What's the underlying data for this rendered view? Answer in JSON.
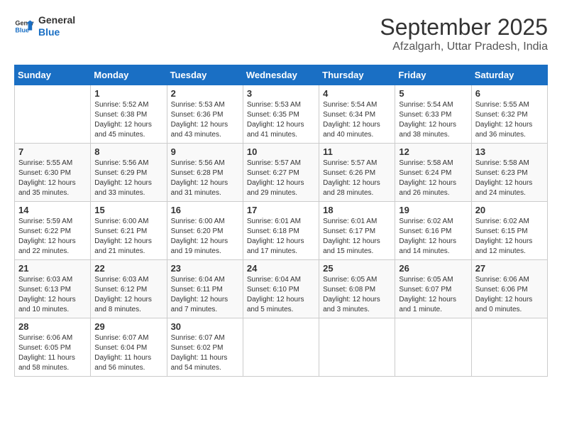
{
  "header": {
    "logo_line1": "General",
    "logo_line2": "Blue",
    "month": "September 2025",
    "location": "Afzalgarh, Uttar Pradesh, India"
  },
  "days_of_week": [
    "Sunday",
    "Monday",
    "Tuesday",
    "Wednesday",
    "Thursday",
    "Friday",
    "Saturday"
  ],
  "weeks": [
    [
      {
        "day": "",
        "info": ""
      },
      {
        "day": "1",
        "info": "Sunrise: 5:52 AM\nSunset: 6:38 PM\nDaylight: 12 hours\nand 45 minutes."
      },
      {
        "day": "2",
        "info": "Sunrise: 5:53 AM\nSunset: 6:36 PM\nDaylight: 12 hours\nand 43 minutes."
      },
      {
        "day": "3",
        "info": "Sunrise: 5:53 AM\nSunset: 6:35 PM\nDaylight: 12 hours\nand 41 minutes."
      },
      {
        "day": "4",
        "info": "Sunrise: 5:54 AM\nSunset: 6:34 PM\nDaylight: 12 hours\nand 40 minutes."
      },
      {
        "day": "5",
        "info": "Sunrise: 5:54 AM\nSunset: 6:33 PM\nDaylight: 12 hours\nand 38 minutes."
      },
      {
        "day": "6",
        "info": "Sunrise: 5:55 AM\nSunset: 6:32 PM\nDaylight: 12 hours\nand 36 minutes."
      }
    ],
    [
      {
        "day": "7",
        "info": "Sunrise: 5:55 AM\nSunset: 6:30 PM\nDaylight: 12 hours\nand 35 minutes."
      },
      {
        "day": "8",
        "info": "Sunrise: 5:56 AM\nSunset: 6:29 PM\nDaylight: 12 hours\nand 33 minutes."
      },
      {
        "day": "9",
        "info": "Sunrise: 5:56 AM\nSunset: 6:28 PM\nDaylight: 12 hours\nand 31 minutes."
      },
      {
        "day": "10",
        "info": "Sunrise: 5:57 AM\nSunset: 6:27 PM\nDaylight: 12 hours\nand 29 minutes."
      },
      {
        "day": "11",
        "info": "Sunrise: 5:57 AM\nSunset: 6:26 PM\nDaylight: 12 hours\nand 28 minutes."
      },
      {
        "day": "12",
        "info": "Sunrise: 5:58 AM\nSunset: 6:24 PM\nDaylight: 12 hours\nand 26 minutes."
      },
      {
        "day": "13",
        "info": "Sunrise: 5:58 AM\nSunset: 6:23 PM\nDaylight: 12 hours\nand 24 minutes."
      }
    ],
    [
      {
        "day": "14",
        "info": "Sunrise: 5:59 AM\nSunset: 6:22 PM\nDaylight: 12 hours\nand 22 minutes."
      },
      {
        "day": "15",
        "info": "Sunrise: 6:00 AM\nSunset: 6:21 PM\nDaylight: 12 hours\nand 21 minutes."
      },
      {
        "day": "16",
        "info": "Sunrise: 6:00 AM\nSunset: 6:20 PM\nDaylight: 12 hours\nand 19 minutes."
      },
      {
        "day": "17",
        "info": "Sunrise: 6:01 AM\nSunset: 6:18 PM\nDaylight: 12 hours\nand 17 minutes."
      },
      {
        "day": "18",
        "info": "Sunrise: 6:01 AM\nSunset: 6:17 PM\nDaylight: 12 hours\nand 15 minutes."
      },
      {
        "day": "19",
        "info": "Sunrise: 6:02 AM\nSunset: 6:16 PM\nDaylight: 12 hours\nand 14 minutes."
      },
      {
        "day": "20",
        "info": "Sunrise: 6:02 AM\nSunset: 6:15 PM\nDaylight: 12 hours\nand 12 minutes."
      }
    ],
    [
      {
        "day": "21",
        "info": "Sunrise: 6:03 AM\nSunset: 6:13 PM\nDaylight: 12 hours\nand 10 minutes."
      },
      {
        "day": "22",
        "info": "Sunrise: 6:03 AM\nSunset: 6:12 PM\nDaylight: 12 hours\nand 8 minutes."
      },
      {
        "day": "23",
        "info": "Sunrise: 6:04 AM\nSunset: 6:11 PM\nDaylight: 12 hours\nand 7 minutes."
      },
      {
        "day": "24",
        "info": "Sunrise: 6:04 AM\nSunset: 6:10 PM\nDaylight: 12 hours\nand 5 minutes."
      },
      {
        "day": "25",
        "info": "Sunrise: 6:05 AM\nSunset: 6:08 PM\nDaylight: 12 hours\nand 3 minutes."
      },
      {
        "day": "26",
        "info": "Sunrise: 6:05 AM\nSunset: 6:07 PM\nDaylight: 12 hours\nand 1 minute."
      },
      {
        "day": "27",
        "info": "Sunrise: 6:06 AM\nSunset: 6:06 PM\nDaylight: 12 hours\nand 0 minutes."
      }
    ],
    [
      {
        "day": "28",
        "info": "Sunrise: 6:06 AM\nSunset: 6:05 PM\nDaylight: 11 hours\nand 58 minutes."
      },
      {
        "day": "29",
        "info": "Sunrise: 6:07 AM\nSunset: 6:04 PM\nDaylight: 11 hours\nand 56 minutes."
      },
      {
        "day": "30",
        "info": "Sunrise: 6:07 AM\nSunset: 6:02 PM\nDaylight: 11 hours\nand 54 minutes."
      },
      {
        "day": "",
        "info": ""
      },
      {
        "day": "",
        "info": ""
      },
      {
        "day": "",
        "info": ""
      },
      {
        "day": "",
        "info": ""
      }
    ]
  ]
}
